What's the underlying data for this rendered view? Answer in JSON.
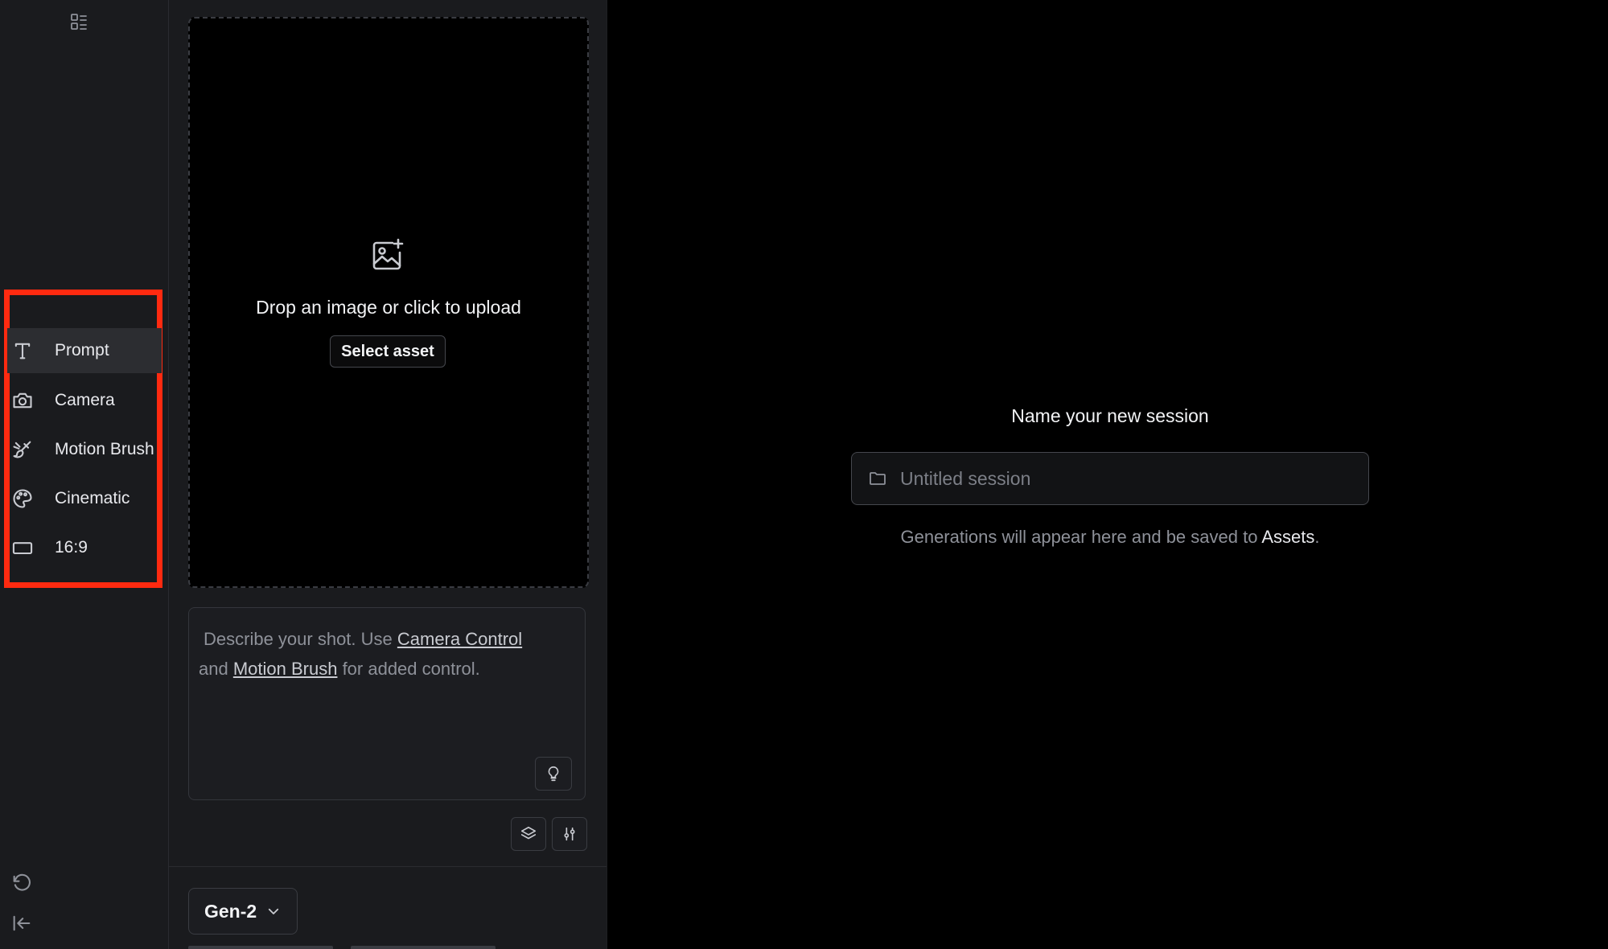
{
  "rail": {
    "top_icon": "grid-list-icon",
    "tools": [
      {
        "label": "Prompt",
        "icon": "text-t-icon",
        "active": true
      },
      {
        "label": "Camera",
        "icon": "camera-icon",
        "active": false
      },
      {
        "label": "Motion Brush",
        "icon": "motion-brush-icon",
        "active": false
      },
      {
        "label": "Cinematic",
        "icon": "palette-icon",
        "active": false
      },
      {
        "label": "16:9",
        "icon": "aspect-ratio-icon",
        "active": false
      }
    ],
    "bottom_icons": [
      "reset-icon",
      "collapse-sidebar-icon"
    ],
    "highlight_color": "#ff2a10"
  },
  "upload": {
    "icon": "image-add-icon",
    "text": "Drop an image or click to upload",
    "button_label": "Select asset"
  },
  "prompt": {
    "text_before": "Describe your shot. Use ",
    "link1": "Camera Control",
    "text_mid": " and ",
    "link2": "Motion Brush",
    "text_after": " for added control.",
    "hint_icon": "lightbulb-icon"
  },
  "toolbar": {
    "icons": [
      "layers-icon",
      "settings-sliders-icon"
    ]
  },
  "model": {
    "selected": "Gen-2"
  },
  "session": {
    "title": "Name your new session",
    "placeholder": "Untitled session",
    "note_before": "Generations will appear here and be saved to ",
    "note_link": "Assets",
    "note_after": "."
  }
}
